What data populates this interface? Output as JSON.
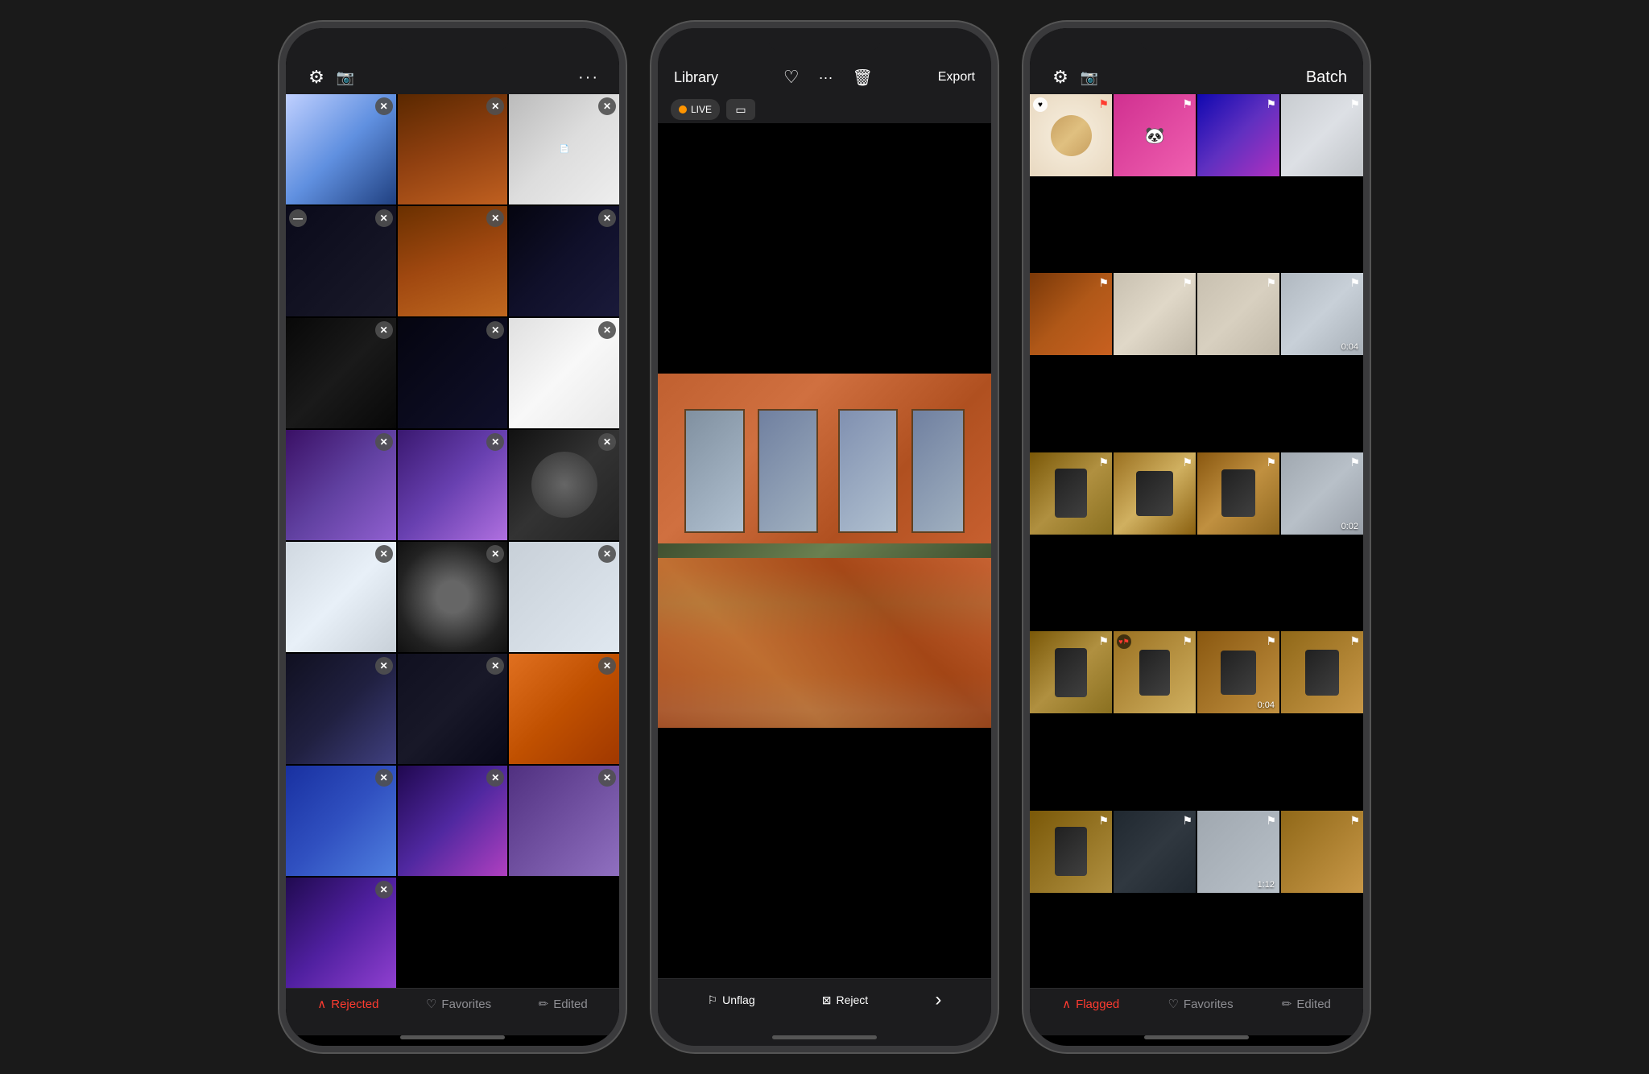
{
  "phones": [
    {
      "id": "left",
      "topBar": {
        "icons": [
          "settings",
          "camera",
          "more"
        ]
      },
      "bottomBar": [
        {
          "label": "Rejected",
          "icon": "arrow-up",
          "active": true
        },
        {
          "label": "Favorites",
          "icon": "heart",
          "active": false
        },
        {
          "label": "Edited",
          "icon": "edit",
          "active": false
        }
      ],
      "grid": "3col"
    },
    {
      "id": "middle",
      "topBar": {
        "title": "Library",
        "icons": [
          "heart",
          "more",
          "trash"
        ],
        "exportLabel": "Export"
      },
      "liveControls": [
        "LIVE",
        "still"
      ],
      "bottomBar": [
        {
          "label": "Unflag",
          "icon": "unflag"
        },
        {
          "label": "Reject",
          "icon": "reject"
        },
        {
          "label": "›",
          "icon": "chevron"
        }
      ],
      "grid": "single"
    },
    {
      "id": "right",
      "topBar": {
        "icons": [
          "settings",
          "camera"
        ],
        "batchLabel": "Batch"
      },
      "bottomBar": [
        {
          "label": "Flagged",
          "icon": "arrow-up",
          "active": true
        },
        {
          "label": "Favorites",
          "icon": "heart",
          "active": false
        },
        {
          "label": "Edited",
          "icon": "edit",
          "active": false
        }
      ],
      "grid": "4col"
    }
  ],
  "leftGrid": {
    "cells": [
      {
        "bg": "bg-blue",
        "hasX": true,
        "xPos": "top-right"
      },
      {
        "bg": "bg-orange",
        "hasX": true
      },
      {
        "bg": "bg-white",
        "hasX": true
      },
      {
        "bg": "bg-dark",
        "hasX": true
      },
      {
        "bg": "bg-orange",
        "hasX": true
      },
      {
        "bg": "bg-screen",
        "hasX": true
      },
      {
        "bg": "bg-dark",
        "hasX": true
      },
      {
        "bg": "bg-screen",
        "hasX": true
      },
      {
        "bg": "bg-screen",
        "hasX": true
      },
      {
        "bg": "bg-dark",
        "hasX": true
      },
      {
        "bg": "bg-screen",
        "hasX": true
      },
      {
        "bg": "bg-purple",
        "hasX": true
      },
      {
        "bg": "bg-purple",
        "hasX": true
      },
      {
        "bg": "bg-gray",
        "hasX": true
      },
      {
        "bg": "bg-gray",
        "hasX": true
      },
      {
        "bg": "bg-gray",
        "hasX": true
      },
      {
        "bg": "bg-teal",
        "hasX": true
      },
      {
        "bg": "bg-purple",
        "hasX": true
      },
      {
        "bg": "bg-dark",
        "hasX": true
      },
      {
        "bg": "bg-pink",
        "hasX": true
      },
      {
        "bg": "bg-blue",
        "hasX": true
      },
      {
        "bg": "bg-dark",
        "hasX": true
      },
      {
        "bg": "bg-gray",
        "hasX": true
      },
      {
        "bg": "bg-yellow",
        "hasX": true
      },
      {
        "bg": "bg-dark",
        "hasX": true
      },
      {
        "bg": "bg-purple",
        "hasX": true
      },
      {
        "bg": "bg-dark",
        "hasX": true
      }
    ]
  },
  "rightGrid": {
    "cells": [
      {
        "bg": "bg-donut",
        "hasFlag": true,
        "flagColor": "red"
      },
      {
        "bg": "bg-pink2",
        "hasFlag": true,
        "flagColor": "white"
      },
      {
        "bg": "bg-gradient-blue",
        "hasFlag": true,
        "flagColor": "white"
      },
      {
        "bg": "bg-white",
        "hasFlag": true,
        "flagColor": "white"
      },
      {
        "bg": "bg-orange",
        "hasFlag": true,
        "flagColor": "white"
      },
      {
        "bg": "bg-white",
        "hasFlag": true,
        "flagColor": "white"
      },
      {
        "bg": "bg-white",
        "hasFlag": true,
        "flagColor": "white"
      },
      {
        "bg": "bg-winter",
        "hasFlag": true,
        "flagColor": "white",
        "duration": "0:04"
      },
      {
        "bg": "bg-wood",
        "hasFlag": true,
        "flagColor": "white"
      },
      {
        "bg": "bg-wood",
        "hasFlag": true,
        "flagColor": "white"
      },
      {
        "bg": "bg-wood",
        "hasFlag": true,
        "flagColor": "white"
      },
      {
        "bg": "bg-winter",
        "hasFlag": true,
        "flagColor": "white",
        "duration": "0:02"
      },
      {
        "bg": "bg-wood",
        "hasFlag": true,
        "flagColor": "white"
      },
      {
        "bg": "bg-wood",
        "hasFlag": true,
        "flagColor": "white"
      },
      {
        "bg": "bg-wood",
        "hasFlag": true,
        "flagColor": "white",
        "duration": "0:04"
      },
      {
        "bg": "bg-wood",
        "hasFlag": true,
        "flagColor": "white"
      },
      {
        "bg": "bg-wood",
        "hasFlag": true,
        "flagColor": "white"
      },
      {
        "bg": "bg-winter",
        "hasFlag": true,
        "flagColor": "white"
      },
      {
        "bg": "bg-winter",
        "hasFlag": true,
        "flagColor": "white",
        "duration": "1:12"
      },
      {
        "bg": "bg-wood",
        "hasFlag": true,
        "flagColor": "white"
      }
    ]
  },
  "labels": {
    "rejected": "Rejected",
    "favorites": "Favorites",
    "edited": "Edited",
    "flagged": "Flagged",
    "library": "Library",
    "export": "Export",
    "unflag": "Unflag",
    "reject": "Reject",
    "batch": "Batch",
    "live": "LIVE"
  }
}
